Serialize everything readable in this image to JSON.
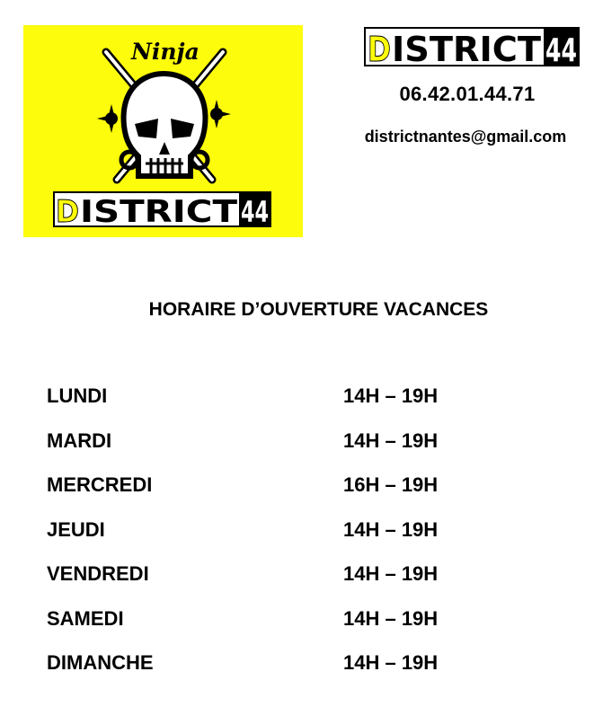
{
  "logo": {
    "ninja_text": "Ninja",
    "brand_prefix": "D",
    "brand_rest": "ISTRICT",
    "brand_number": "44",
    "background_color": "#fdfc0c"
  },
  "header": {
    "wordmark_prefix": "D",
    "wordmark_rest": "ISTRICT",
    "wordmark_number": "44",
    "phone": "06.42.01.44.71",
    "email": "districtnantes@gmail.com"
  },
  "schedule": {
    "title": "HORAIRE D’OUVERTURE VACANCES",
    "rows": [
      {
        "day": "LUNDI",
        "hours": "14H – 19H"
      },
      {
        "day": "MARDI",
        "hours": "14H – 19H"
      },
      {
        "day": "MERCREDI",
        "hours": "16H – 19H"
      },
      {
        "day": "JEUDI",
        "hours": "14H – 19H"
      },
      {
        "day": "VENDREDI",
        "hours": "14H – 19H"
      },
      {
        "day": "SAMEDI",
        "hours": "14H – 19H"
      },
      {
        "day": "DIMANCHE",
        "hours": "14H – 19H"
      }
    ]
  }
}
